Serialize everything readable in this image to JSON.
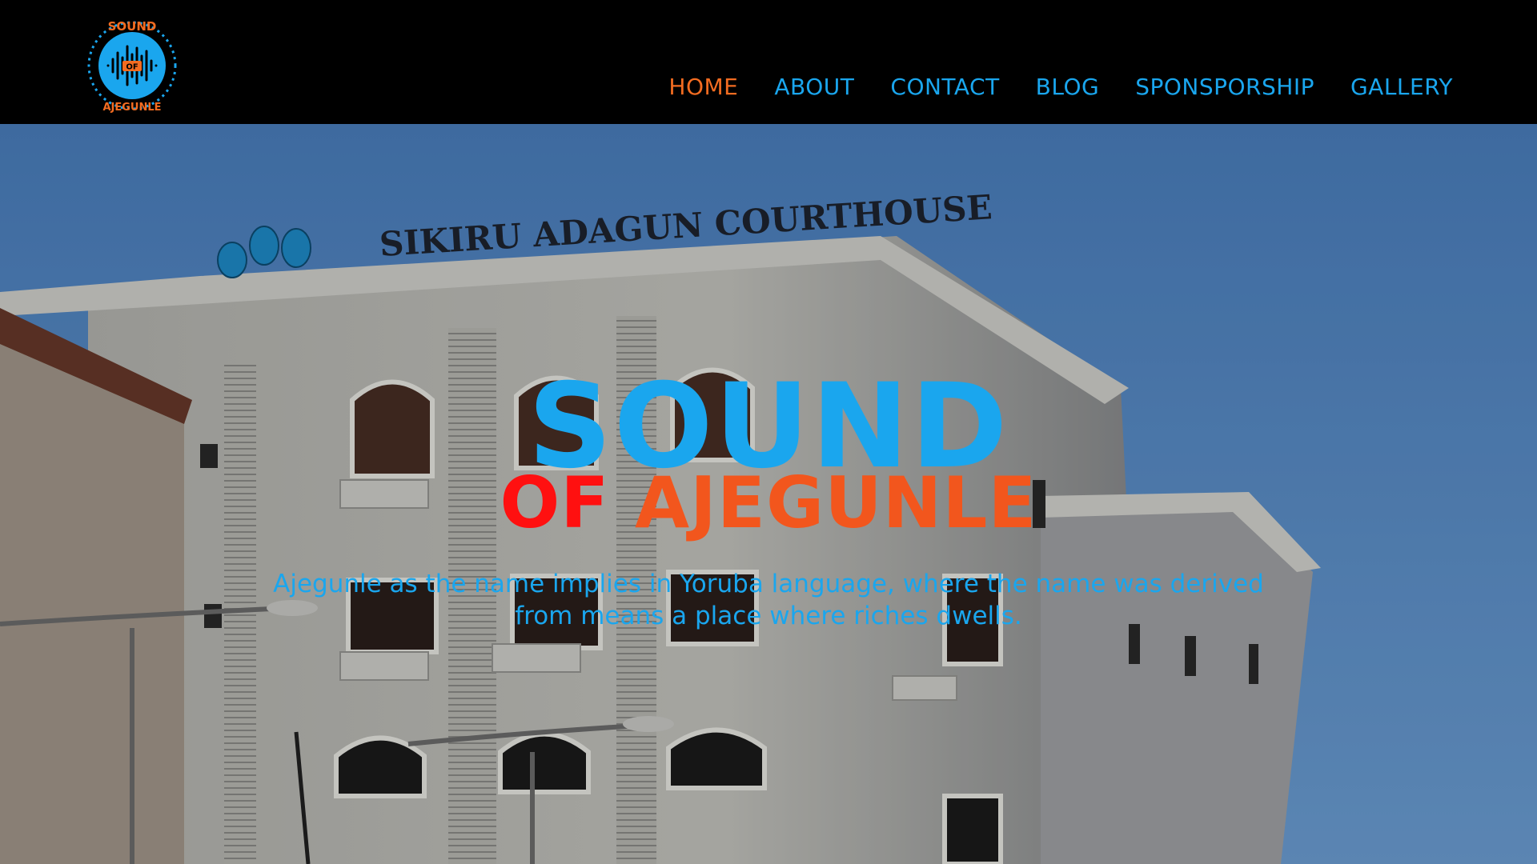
{
  "brand": {
    "logo_alt": "SOUND OF AJEGUNLE",
    "logo_top": "SOUND",
    "logo_mid": "OF",
    "logo_bottom": "AJEGUNLE"
  },
  "nav": {
    "items": [
      {
        "label": "HOME",
        "active": true
      },
      {
        "label": "ABOUT",
        "active": false
      },
      {
        "label": "CONTACT",
        "active": false
      },
      {
        "label": "BLOG",
        "active": false
      },
      {
        "label": "SPONSPORSHIP",
        "active": false
      },
      {
        "label": "GALLERY",
        "active": false
      }
    ]
  },
  "hero": {
    "sign_text": "SIKIRU ADAGUN COURTHOUSE",
    "title_main": "SOUND",
    "title_of": "OF",
    "title_place": "AJEGUNLE",
    "tagline": "Ajegunle as the name implies in Yoruba language, where the name was derived from means a place where riches dwells."
  },
  "colors": {
    "accent_blue": "#1AA6EE",
    "accent_orange": "#F36C21",
    "accent_red": "#FF1010",
    "header_bg": "#000000",
    "sky": "#5C92CF"
  },
  "icons": {
    "logo": "sound-of-ajegunle-logo-icon"
  }
}
